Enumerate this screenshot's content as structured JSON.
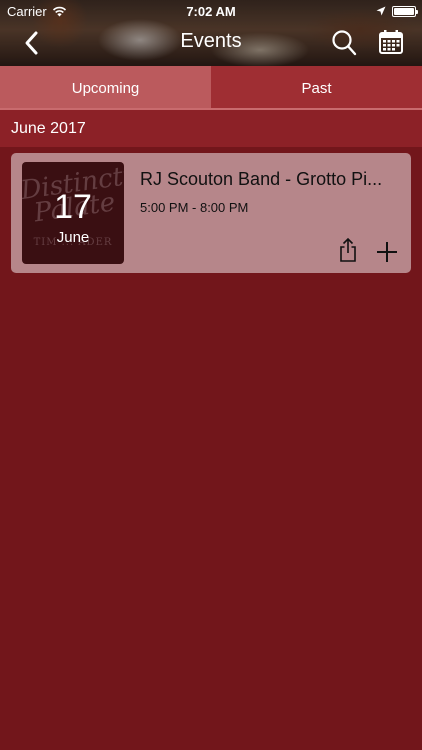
{
  "status_bar": {
    "carrier": "Carrier",
    "time": "7:02 AM"
  },
  "nav": {
    "title": "Events",
    "back_icon": "chevron-left-icon",
    "search_icon": "search-icon",
    "calendar_icon": "calendar-icon"
  },
  "tabs": [
    {
      "label": "Upcoming",
      "active": true
    },
    {
      "label": "Past",
      "active": false
    }
  ],
  "section": {
    "month_label": "June 2017"
  },
  "events": [
    {
      "day": "17",
      "month": "June",
      "title": "RJ Scouton Band - Grotto Pi...",
      "time": "5:00 PM - 8:00 PM",
      "thumb_text": "Distinctive Palate",
      "thumb_subtext": "TIM ... ADER"
    }
  ],
  "colors": {
    "background": "#72161b",
    "tab_active": "#bb5a5d",
    "tab_inactive": "#9f2e33",
    "month_bar": "#8c2127",
    "card": "#b6868a"
  }
}
